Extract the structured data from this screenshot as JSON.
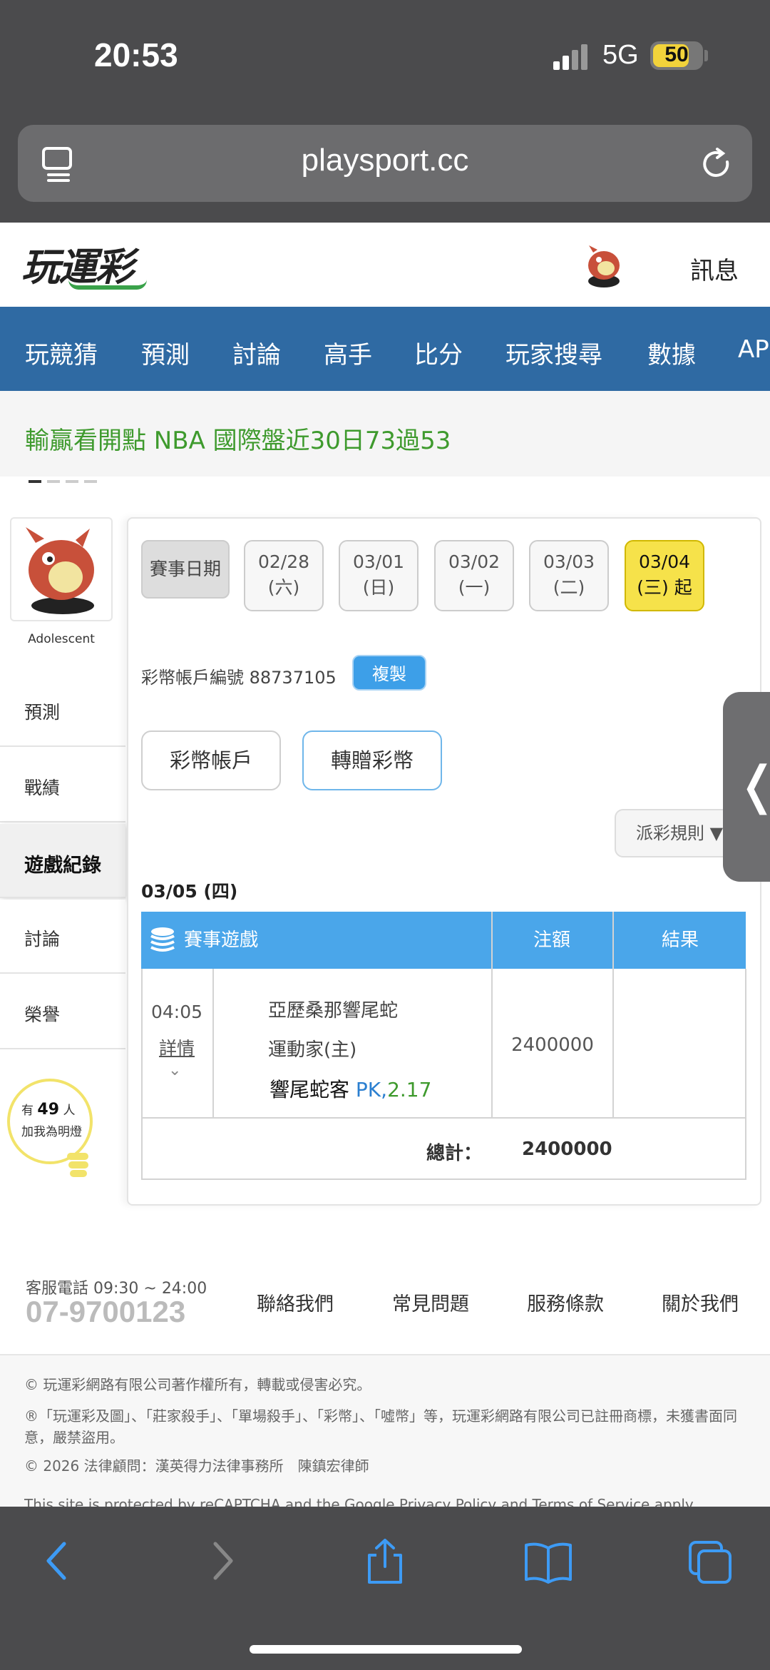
{
  "status_bar": {
    "time": "20:53",
    "network": "5G",
    "battery": "50"
  },
  "browser": {
    "url": "playsport.cc"
  },
  "site": {
    "logo": "玩運彩",
    "messages": "訊息",
    "nav": [
      "玩競猜",
      "預測",
      "討論",
      "高手",
      "比分",
      "玩家搜尋",
      "數據",
      "AP"
    ],
    "banner": "輸贏看開點 NBA 國際盤近30日73過53"
  },
  "sidebar": {
    "username": "Adolescent",
    "items": [
      {
        "label": "預測"
      },
      {
        "label": "戰績"
      },
      {
        "label": "遊戲紀錄"
      },
      {
        "label": "討論"
      },
      {
        "label": "榮譽"
      }
    ],
    "lamp": {
      "prefix": "有",
      "count": "49",
      "suffix": "人",
      "text": "加我為明燈"
    }
  },
  "main": {
    "date_label": "賽事日期",
    "dates": [
      {
        "date": "02/28",
        "day": "(六)"
      },
      {
        "date": "03/01",
        "day": "(日)"
      },
      {
        "date": "03/02",
        "day": "(一)"
      },
      {
        "date": "03/03",
        "day": "(二)"
      },
      {
        "date": "03/04",
        "day": "(三) 起"
      }
    ],
    "account_text": "彩幣帳戶編號 88737105",
    "copy_label": "複製",
    "btn_account": "彩幣帳戶",
    "btn_transfer": "轉贈彩幣",
    "rule_label": "派彩規則 ▼",
    "day_title": "03/05 (四)",
    "table": {
      "headers": [
        "賽事遊戲",
        "注額",
        "結果"
      ],
      "row": {
        "time": "04:05",
        "detail": "詳情",
        "team1": "亞歷桑那響尾蛇",
        "team2": "運動家(主)",
        "pick": "響尾蛇客",
        "pk": "PK,",
        "odds": "2.17",
        "amount": "2400000",
        "result": ""
      },
      "total_label": "總計：",
      "total_value": "2400000"
    }
  },
  "footer": {
    "phone_label": "客服電話 09:30 ~ 24:00",
    "phone": "07-9700123",
    "links": [
      "聯絡我們",
      "常見問題",
      "服務條款",
      "關於我們"
    ],
    "copyright": "© 玩運彩網路有限公司著作權所有，轉載或侵害必究。",
    "trademark": "®「玩運彩及圖」、「莊家殺手」、「單場殺手」、「彩幣」、「噓幣」等，玩運彩網路有限公司已註冊商標，未獲書面同意，嚴禁盜用。",
    "legal": "© 2026 法律顧問：漢英得力法律事務所　陳鎮宏律師",
    "recaptcha": "This site is protected by reCAPTCHA and the Google Privacy Policy and Terms of Service apply."
  },
  "colors": {
    "nav_blue": "#2f6aa3",
    "table_blue": "#4aa6ea",
    "selected_date": "#f6e24a",
    "green_text": "#3e9a2d"
  }
}
